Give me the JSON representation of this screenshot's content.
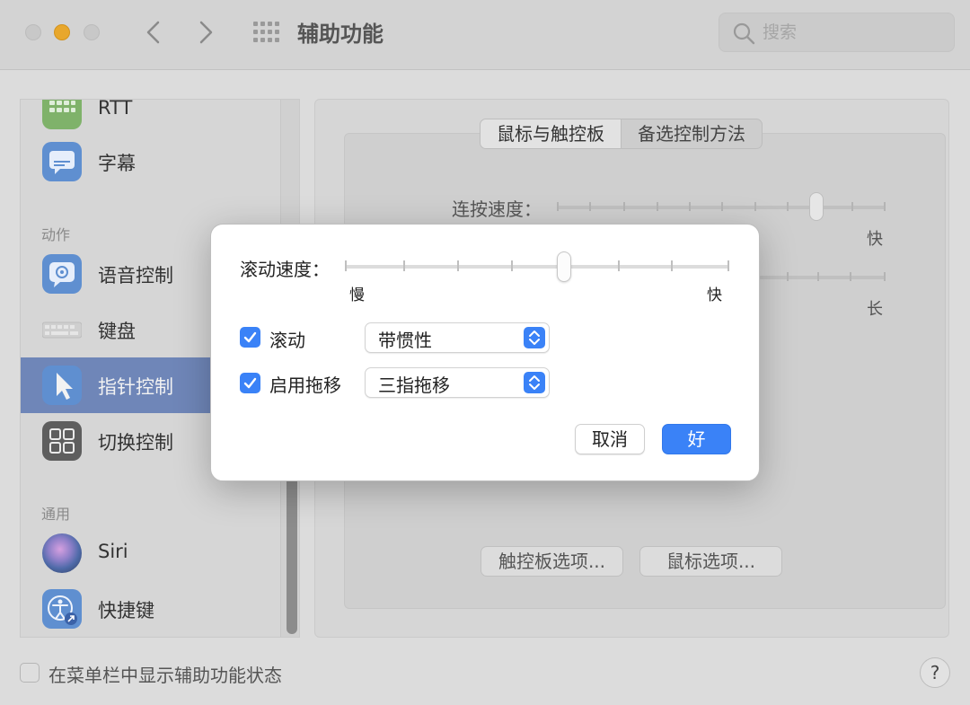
{
  "window": {
    "title": "辅助功能",
    "search_placeholder": "搜索"
  },
  "sidebar": {
    "items": [
      {
        "label": "RTT",
        "icon": "keyboard-icon"
      },
      {
        "label": "字幕",
        "icon": "captions-icon"
      },
      {
        "label": "语音控制",
        "icon": "voice-control-icon"
      },
      {
        "label": "键盘",
        "icon": "keyboard-icon"
      },
      {
        "label": "指针控制",
        "icon": "pointer-icon"
      },
      {
        "label": "切换控制",
        "icon": "switch-control-icon"
      },
      {
        "label": "Siri",
        "icon": "siri-icon"
      },
      {
        "label": "快捷键",
        "icon": "accessibility-shortcut-icon"
      }
    ],
    "sections": {
      "actions": "动作",
      "general": "通用"
    },
    "selected": "指针控制"
  },
  "main": {
    "tabs": [
      "鼠标与触控板",
      "备选控制方法"
    ],
    "active_tab": "鼠标与触控板",
    "double_click_label": "连按速度：",
    "fast_label": "快",
    "long_label": "长",
    "trackpad_options_button": "触控板选项...",
    "mouse_options_button": "鼠标选项..."
  },
  "dialog": {
    "scroll_speed_label": "滚动速度：",
    "slow_label": "慢",
    "fast_label": "快",
    "scroll_speed_ticks": 8,
    "scroll_speed_value": 0.56,
    "scrolling": {
      "checked": true,
      "label": "滚动",
      "option": "带惯性"
    },
    "dragging": {
      "checked": true,
      "label": "启用拖移",
      "option": "三指拖移"
    },
    "cancel_button": "取消",
    "ok_button": "好"
  },
  "bottom": {
    "show_status_label": "在菜单栏中显示辅助功能状态",
    "show_status_checked": false,
    "help": "?"
  },
  "colors": {
    "accent": "#3a82f7",
    "selection": "#6f86b8",
    "minimize": "#e8a72c"
  }
}
